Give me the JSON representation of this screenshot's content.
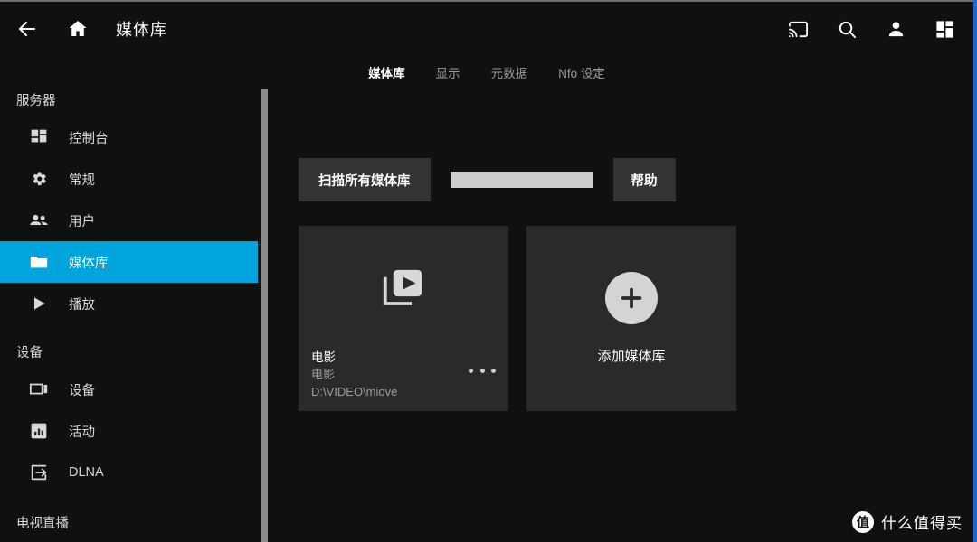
{
  "colors": {
    "background": "#101010",
    "accent": "#00a4dc",
    "card": "#2a2a2a",
    "button": "#333333",
    "progress": "#cccccc",
    "scrollbar": "#8a8a8a",
    "right_edge": "#2266cc",
    "muted_text": "#9c9c9c"
  },
  "header": {
    "title": "媒体库",
    "back_icon": "arrow-left-icon",
    "home_icon": "home-icon",
    "actions": [
      {
        "name": "cast-icon",
        "label": "投放"
      },
      {
        "name": "search-icon",
        "label": "搜索"
      },
      {
        "name": "person-icon",
        "label": "用户"
      },
      {
        "name": "dashboard-icon",
        "label": "控制台"
      }
    ]
  },
  "tabs": [
    {
      "label": "媒体库",
      "active": true
    },
    {
      "label": "显示",
      "active": false
    },
    {
      "label": "元数据",
      "active": false
    },
    {
      "label": "Nfo 设定",
      "active": false
    }
  ],
  "sidebar": {
    "sections": [
      {
        "title": "服务器",
        "items": [
          {
            "label": "控制台",
            "icon": "dashboard-icon",
            "active": false
          },
          {
            "label": "常规",
            "icon": "gear-icon",
            "active": false
          },
          {
            "label": "用户",
            "icon": "people-icon",
            "active": false
          },
          {
            "label": "媒体库",
            "icon": "folder-icon",
            "active": true
          },
          {
            "label": "播放",
            "icon": "play-icon",
            "active": false
          }
        ]
      },
      {
        "title": "设备",
        "items": [
          {
            "label": "设备",
            "icon": "tablet-icon",
            "active": false
          },
          {
            "label": "活动",
            "icon": "bar-chart-icon",
            "active": false
          },
          {
            "label": "DLNA",
            "icon": "input-icon",
            "active": false
          }
        ]
      },
      {
        "title": "电视直播",
        "items": []
      }
    ]
  },
  "main": {
    "toolbar": {
      "scan_label": "扫描所有媒体库",
      "help_label": "帮助"
    },
    "libraries": [
      {
        "title": "电影",
        "subtitle": "电影",
        "path": "D:\\VIDEO\\miove",
        "icon": "video-library-icon",
        "menu_icon": "more-horizontal-icon"
      }
    ],
    "add_card": {
      "label": "添加媒体库",
      "icon": "plus-icon"
    }
  },
  "watermark": {
    "logo_char": "值",
    "text": "什么值得买"
  }
}
